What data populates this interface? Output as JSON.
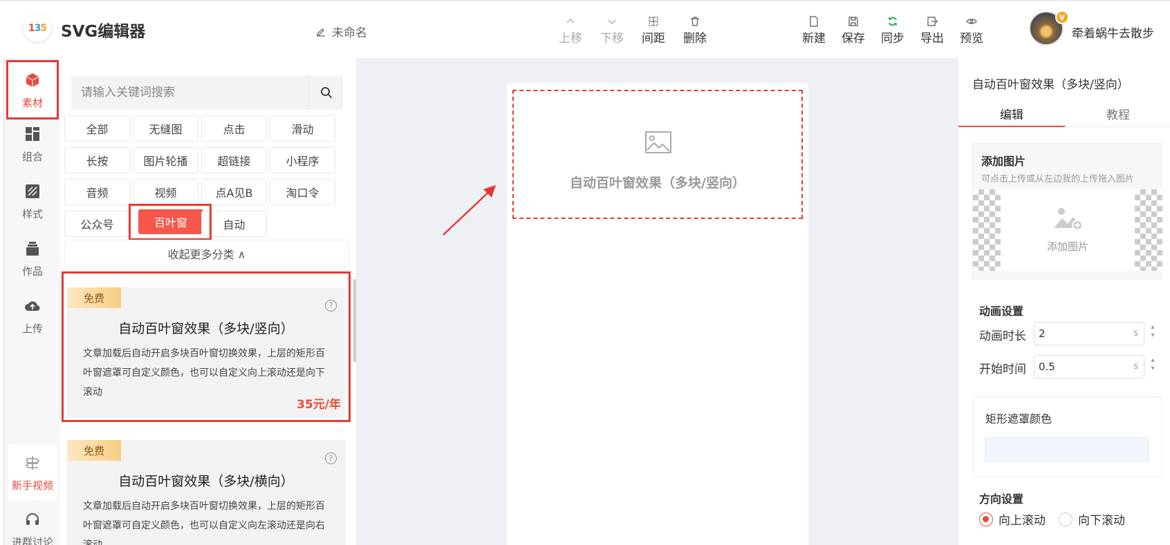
{
  "header": {
    "logo_text": [
      "1",
      "3",
      "5"
    ],
    "app_title": "SVG编辑器",
    "doc_name": "未命名",
    "toolbar": {
      "move_up": "上移",
      "move_down": "下移",
      "spacing": "间距",
      "delete": "删除",
      "new": "新建",
      "save": "保存",
      "sync": "同步",
      "export": "导出",
      "preview": "预览"
    },
    "avatar_badge": "v",
    "username": "牵着蜗牛去散步"
  },
  "rail": {
    "items": [
      {
        "label": "素材",
        "icon": "cube-icon"
      },
      {
        "label": "组合",
        "icon": "grid-icon"
      },
      {
        "label": "样式",
        "icon": "style-icon"
      },
      {
        "label": "作品",
        "icon": "stack-icon"
      },
      {
        "label": "上传",
        "icon": "cloud-upload-icon"
      },
      {
        "label": "新手视频",
        "icon": "signpost-icon"
      },
      {
        "label": "进群讨论",
        "icon": "headset-icon"
      }
    ]
  },
  "sidebar": {
    "search_placeholder": "请输入关键词搜索",
    "categories": [
      "全部",
      "无缝图",
      "点击",
      "滑动",
      "长按",
      "图片轮播",
      "超链接",
      "小程序",
      "音频",
      "视频",
      "点A见B",
      "淘口令",
      "公众号",
      "百叶窗",
      "自动"
    ],
    "active_category": "百叶窗",
    "collapse_label": "收起更多分类 ∧",
    "cards": [
      {
        "tag": "免费",
        "title": "自动百叶窗效果（多块/竖向）",
        "desc": "文章加载后自动开启多块百叶窗切换效果，上层的矩形百叶窗遮罩可自定义颜色，也可以自定义向上滚动还是向下滚动",
        "price": "35元/年"
      },
      {
        "tag": "免费",
        "title": "自动百叶窗效果（多块/横向）",
        "desc": "文章加载后自动开启多块百叶窗切换效果，上层的矩形百叶窗遮罩可自定义颜色，也可以自定义向左滚动还是向右滚动"
      }
    ]
  },
  "canvas": {
    "placeholder_text": "自动百叶窗效果（多块/竖向）"
  },
  "rpanel": {
    "title": "自动百叶窗效果（多块/竖向）",
    "tabs": [
      "编辑",
      "教程"
    ],
    "add_image": {
      "heading": "添加图片",
      "hint": "可点击上传或从左边我的上传拖入图片",
      "button": "添加图片"
    },
    "animation": {
      "heading": "动画设置",
      "duration_label": "动画时长",
      "duration_value": "2",
      "start_label": "开始时间",
      "start_value": "0.5",
      "unit": "s"
    },
    "mask": {
      "label": "矩形遮罩颜色",
      "color": "#f1f5fd"
    },
    "direction": {
      "heading": "方向设置",
      "options": [
        "向上滚动",
        "向下滚动"
      ],
      "selected": "向上滚动"
    }
  },
  "colors": {
    "accent": "#e94b3c",
    "highlight": "#e53935",
    "canvas_bg": "#eef0f5"
  }
}
